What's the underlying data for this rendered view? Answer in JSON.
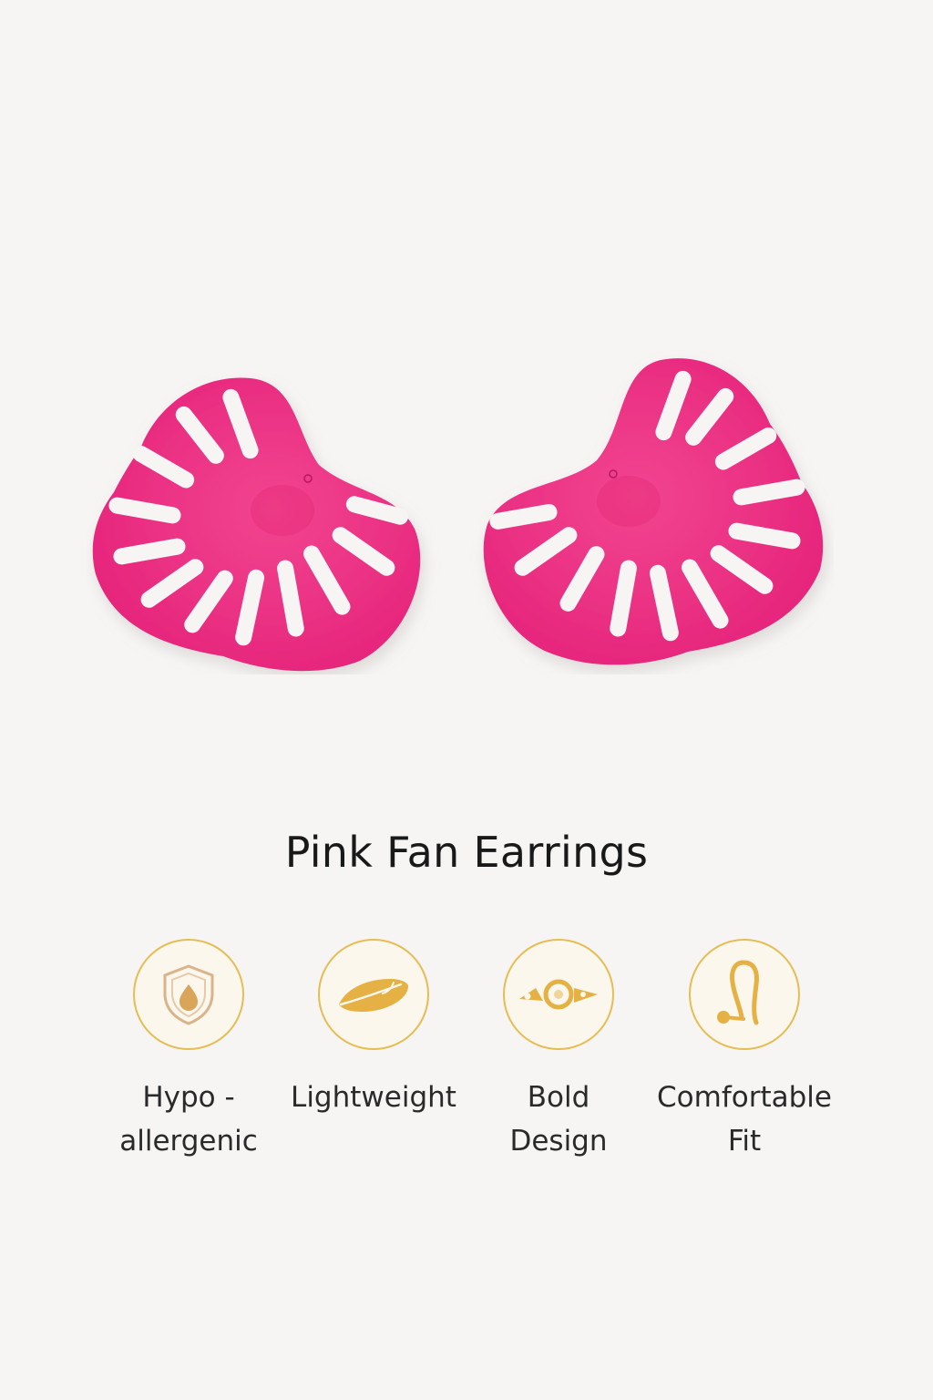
{
  "product": {
    "title": "Pink Fan Earrings"
  },
  "colors": {
    "earring_pink": "#ef2c85",
    "accent_gold": "#e5b144",
    "badge_border": "#e6bd54",
    "background": "#f6f5f4"
  },
  "features": [
    {
      "label": "Hypo -\nallergenic",
      "icon": "shield-icon"
    },
    {
      "label": "Lightweight",
      "icon": "feather-icon"
    },
    {
      "label": "Bold\nDesign",
      "icon": "gem-icon"
    },
    {
      "label": "Comfortable\nFit",
      "icon": "earring-hook-icon"
    }
  ]
}
